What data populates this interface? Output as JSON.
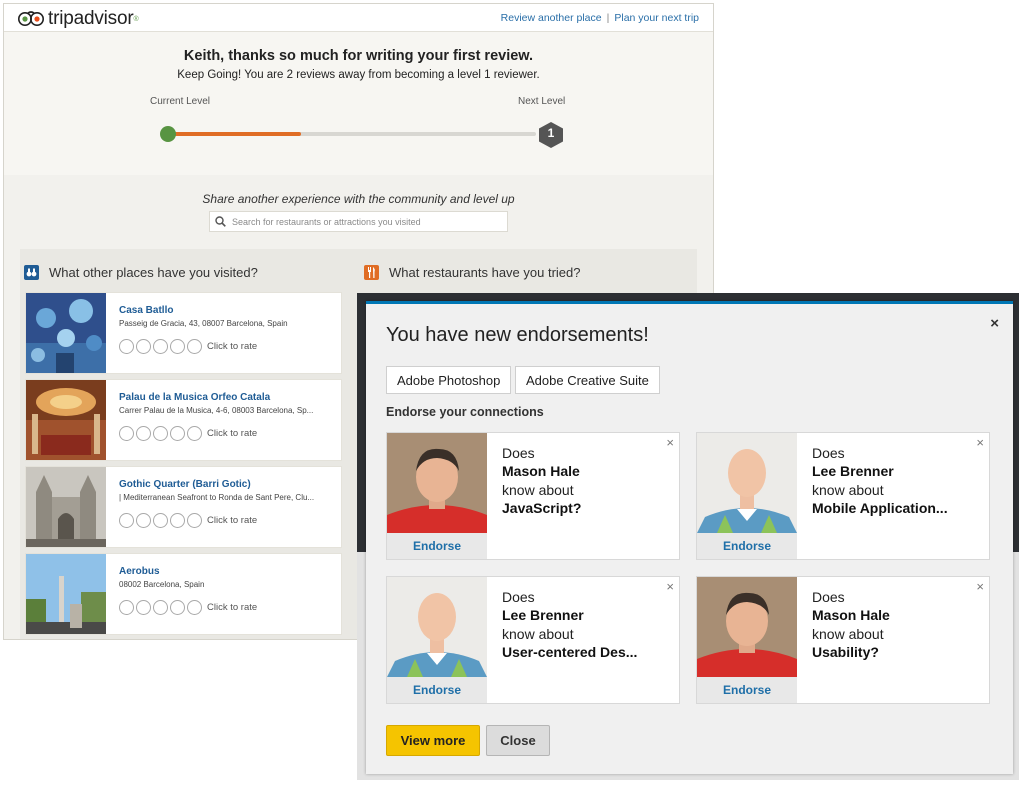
{
  "tripadvisor": {
    "logo_text": "tripadvisor",
    "header_links": [
      "Review another place",
      "Plan your next trip"
    ],
    "heading": "Keith, thanks so much for writing your first review.",
    "subheading": "Keep Going! You are 2 reviews away from becoming a level 1 reviewer.",
    "current_level_label": "Current Level",
    "next_level_label": "Next Level",
    "next_level_number": "1",
    "progress_fraction": 0.35,
    "share_text": "Share another experience with the community and level up",
    "search_placeholder": "Search for restaurants or attractions you visited",
    "places_heading": "What other places have you visited?",
    "restaurants_heading": "What restaurants have you tried?",
    "rate_label": "Click to rate",
    "places": [
      {
        "name": "Casa Batllo",
        "address": "Passeig de Gracia, 43, 08007 Barcelona, Spain"
      },
      {
        "name": "Palau de la Musica Orfeo Catala",
        "address": "Carrer Palau de la Musica, 4-6, 08003 Barcelona, Sp..."
      },
      {
        "name": "Gothic Quarter (Barri Gotic)",
        "address": "| Mediterranean Seafront to Ronda de Sant Pere, Clu..."
      },
      {
        "name": "Aerobus",
        "address": "08002 Barcelona, Spain"
      }
    ],
    "colors": {
      "green": "#589442",
      "orange": "#e06d25",
      "link": "#1f5c95"
    }
  },
  "endorsements": {
    "title": "You have new endorsements!",
    "close_icon": "×",
    "skills": [
      "Adobe Photoshop",
      "Adobe Creative Suite"
    ],
    "subtitle": "Endorse your connections",
    "cards": [
      {
        "does": "Does",
        "person": "Mason Hale",
        "know": "know about",
        "skill": "JavaScript?",
        "action": "Endorse",
        "dismiss": "×"
      },
      {
        "does": "Does",
        "person": "Lee Brenner",
        "know": "know about",
        "skill": "Mobile Application...",
        "action": "Endorse",
        "dismiss": "×"
      },
      {
        "does": "Does",
        "person": "Lee Brenner",
        "know": "know about",
        "skill": "User-centered Des...",
        "action": "Endorse",
        "dismiss": "×"
      },
      {
        "does": "Does",
        "person": "Mason Hale",
        "know": "know about",
        "skill": "Usability?",
        "action": "Endorse",
        "dismiss": "×"
      }
    ],
    "view_more_label": "View more",
    "close_label": "Close",
    "colors": {
      "accent": "#0077b5",
      "primary_button": "#f5c400"
    }
  }
}
